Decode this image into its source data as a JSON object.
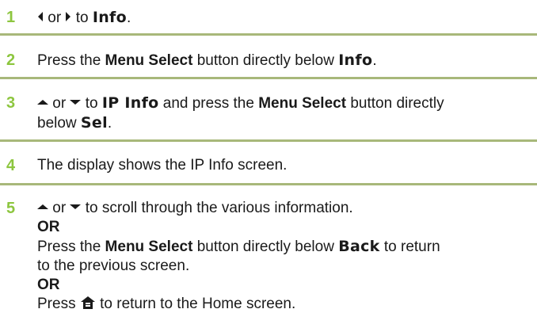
{
  "steps": [
    {
      "number": "1",
      "t1": " or ",
      "t2": " to ",
      "display": "Info",
      "t3": "."
    },
    {
      "number": "2",
      "t1": "Press the ",
      "bold": "Menu Select",
      "t2": " button directly below ",
      "display": "Info",
      "t3": "."
    },
    {
      "number": "3",
      "t1": " or ",
      "t2": " to ",
      "display1": "IP Info",
      "t3": " and press the ",
      "bold": "Menu Select",
      "t4": " button directly",
      "t5": "below ",
      "display2": "Sel",
      "t6": "."
    },
    {
      "number": "4",
      "text": "The display shows the IP Info screen."
    },
    {
      "number": "5",
      "t1": " or ",
      "t2": " to scroll through the various information.",
      "or1": "OR",
      "t3": "Press the ",
      "bold": "Menu Select",
      "t4": " button directly below ",
      "display": "Back",
      "t5": " to return",
      "t6": "to the previous screen.",
      "or2": "OR",
      "t7": "Press ",
      "t8": " to return to the Home screen."
    }
  ],
  "icons": {
    "left": "left-arrow-icon",
    "right": "right-arrow-icon",
    "up": "up-arrow-icon",
    "down": "down-arrow-icon",
    "home": "home-icon"
  },
  "colors": {
    "step_number": "#8dc63f",
    "rule": "#a8b87a",
    "text": "#1a1a1a"
  }
}
